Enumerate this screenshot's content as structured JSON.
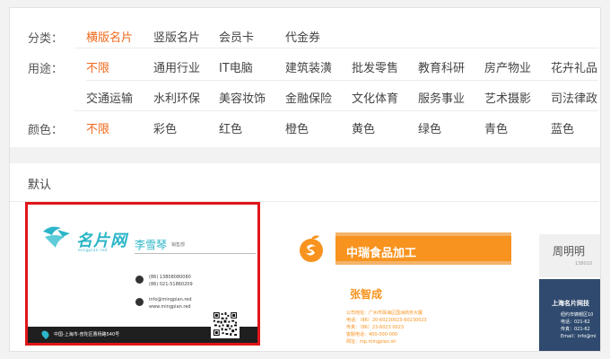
{
  "filters": {
    "category": {
      "label": "分类：",
      "options": [
        "横版名片",
        "竖版名片",
        "会员卡",
        "代金券"
      ]
    },
    "purpose": {
      "label": "用途：",
      "row1": [
        "不限",
        "通用行业",
        "IT电脑",
        "建筑装潢",
        "批发零售",
        "教育科研",
        "房产物业",
        "花卉礼品"
      ],
      "row2": [
        "交通运输",
        "水利环保",
        "美容妆饰",
        "金融保险",
        "文化体育",
        "服务事业",
        "艺术摄影",
        "司法律政"
      ]
    },
    "color": {
      "label": "颜色：",
      "options": [
        "不限",
        "彩色",
        "红色",
        "橙色",
        "黄色",
        "绿色",
        "青色",
        "蓝色"
      ]
    }
  },
  "sort": {
    "label": "默认"
  },
  "colors": {
    "accent": "#f06a1d",
    "selection": "#e0161a",
    "teal": "#2cb5c8",
    "orange": "#f7931e",
    "navy": "#2f4a6e"
  },
  "cards": [
    {
      "brand": "名片网",
      "brand_sub": "mingpian.red",
      "name": "李雪琴",
      "title": "销售部",
      "phone1": "(86) 13808080080",
      "phone2": "(86) 021-51860209",
      "email": "info@mingpian.red",
      "web": "www.mingpian.red",
      "address": "中国-上海市-普陀区曹杨路540号"
    },
    {
      "company": "中瑞食品加工",
      "name": "张智成",
      "address": "公司地址：广州市珠海区国洲商务大厦",
      "phone": "电话：（86）20-60230023-60230023",
      "fax": "传真：（86）23-6023 0023",
      "mobile": "客服电话：400-000-000",
      "web": "网址：mp.mingpian.sh"
    },
    {
      "name": "周明明",
      "sub": "138010",
      "company": "上海名片网技",
      "addr": "纽约市铸帽区10",
      "phone": "电话：021-62",
      "fax": "传真：021-62",
      "email": "Email：info@mi"
    }
  ]
}
